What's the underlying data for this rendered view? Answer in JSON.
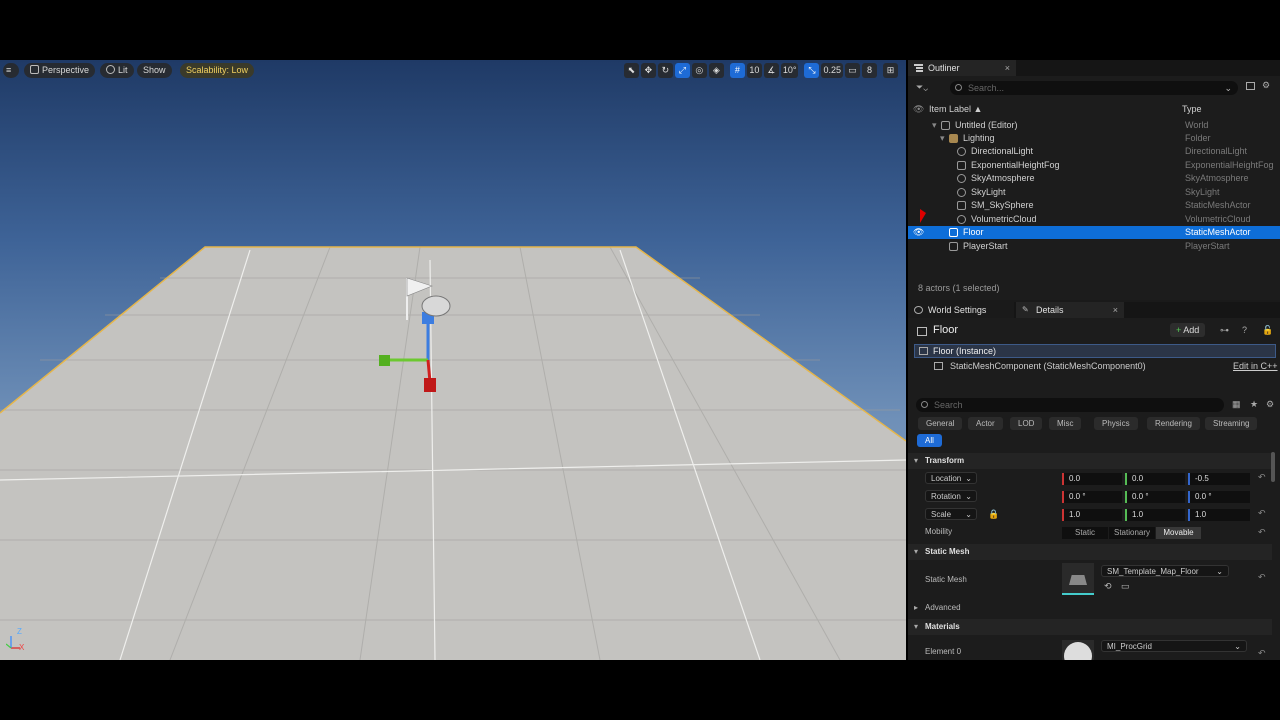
{
  "viewport": {
    "menu_icon": "hamburger-icon",
    "perspective": "Perspective",
    "lit": "Lit",
    "show": "Show",
    "scalability": "Scalability: Low",
    "grid_snap": "10",
    "rotation_snap": "10°",
    "scale_snap": "0.25",
    "camera_speed": "8",
    "axis_labels": {
      "z": "Z",
      "x": "X"
    }
  },
  "outliner": {
    "tab_title": "Outliner",
    "close": "×",
    "search_placeholder": "Search...",
    "col_label": "Item Label ▲",
    "col_type": "Type",
    "rows": [
      {
        "label": "Untitled (Editor)",
        "type": "World"
      },
      {
        "label": "Lighting",
        "type": "Folder"
      },
      {
        "label": "DirectionalLight",
        "type": "DirectionalLight"
      },
      {
        "label": "ExponentialHeightFog",
        "type": "ExponentialHeightFog"
      },
      {
        "label": "SkyAtmosphere",
        "type": "SkyAtmosphere"
      },
      {
        "label": "SkyLight",
        "type": "SkyLight"
      },
      {
        "label": "SM_SkySphere",
        "type": "StaticMeshActor"
      },
      {
        "label": "VolumetricCloud",
        "type": "VolumetricCloud"
      },
      {
        "label": "Floor",
        "type": "StaticMeshActor"
      },
      {
        "label": "PlayerStart",
        "type": "PlayerStart"
      }
    ],
    "status": "8 actors (1 selected)"
  },
  "details": {
    "tab_world": "World Settings",
    "tab_details": "Details",
    "close": "×",
    "actor_name": "Floor",
    "add_label": "Add",
    "instance": "Floor (Instance)",
    "component": "StaticMeshComponent (StaticMeshComponent0)",
    "edit_cpp": "Edit in C++",
    "search_placeholder": "Search",
    "filters": [
      "General",
      "Actor",
      "LOD",
      "Misc",
      "Physics",
      "Rendering",
      "Streaming"
    ],
    "filter_all": "All",
    "transform": {
      "title": "Transform",
      "location_label": "Location",
      "rotation_label": "Rotation",
      "scale_label": "Scale",
      "location": [
        "0.0",
        "0.0",
        "-0.5"
      ],
      "rotation": [
        "0.0 °",
        "0.0 °",
        "0.0 °"
      ],
      "scale": [
        "1.0",
        "1.0",
        "1.0"
      ],
      "mobility_label": "Mobility",
      "mobility": [
        "Static",
        "Stationary",
        "Movable"
      ]
    },
    "static_mesh": {
      "title": "Static Mesh",
      "label": "Static Mesh",
      "value": "SM_Template_Map_Floor"
    },
    "advanced": "Advanced",
    "materials": {
      "title": "Materials",
      "element0_label": "Element 0",
      "element0_value": "MI_ProcGrid"
    }
  }
}
